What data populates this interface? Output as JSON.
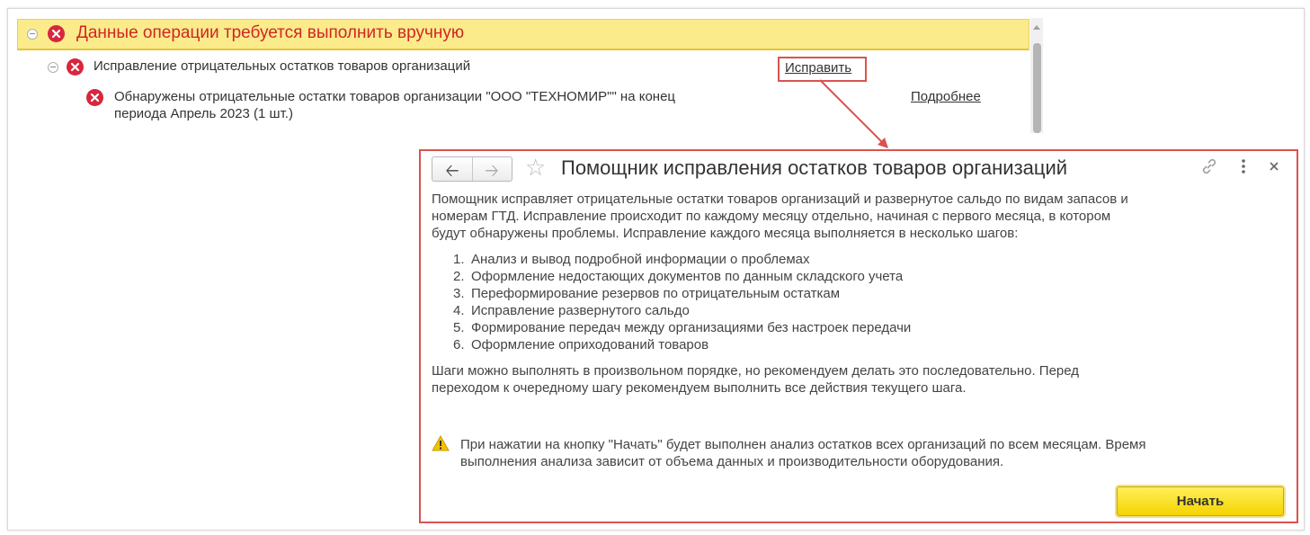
{
  "colors": {
    "group_bg": "#fbeb8b",
    "error_red": "#d7263d",
    "highlight_border": "#d9534f",
    "start_button": "#f4d400"
  },
  "list": {
    "group_title": "Данные операции требуется выполнить вручную",
    "item_title": "Исправление отрицательных остатков товаров организаций",
    "fix_link": "Исправить",
    "detail_line1": "Обнаружены отрицательные остатки товаров организации \"ООО \"ТЕХНОМИР\"\" на конец",
    "detail_line2": "периода Апрель 2023 (1 шт.)",
    "more_link": "Подробнее"
  },
  "dialog": {
    "title": "Помощник исправления остатков товаров организаций",
    "back_icon": "arrow-left-icon",
    "forward_icon": "arrow-right-icon",
    "favorite_icon": "star-icon",
    "link_icon": "link-icon",
    "more_icon": "more-vertical-icon",
    "close_icon": "close-icon",
    "intro_lines": [
      "Помощник исправляет отрицательные остатки товаров организаций и развернутое сальдо по видам запасов и",
      "номерам ГТД. Исправление происходит по каждому месяцу отдельно, начиная с первого месяца, в котором",
      "будут обнаружены проблемы. Исправление каждого месяца выполняется в несколько шагов:"
    ],
    "steps": [
      {
        "num": "1.",
        "text": "Анализ и вывод подробной информации о проблемах"
      },
      {
        "num": "2.",
        "text": "Оформление недостающих документов по данным складского учета"
      },
      {
        "num": "3.",
        "text": "Переформирование резервов по отрицательным остаткам"
      },
      {
        "num": "4.",
        "text": "Исправление развернутого сальдо"
      },
      {
        "num": "5.",
        "text": "Формирование передач между организациями без настроек передачи"
      },
      {
        "num": "6.",
        "text": "Оформление оприходований товаров"
      }
    ],
    "para2_lines": [
      "Шаги можно выполнять в произвольном порядке, но рекомендуем делать это последовательно. Перед",
      "переходом к очередному шагу рекомендуем выполнить все действия текущего шага."
    ],
    "warning_lines": [
      "При нажатии на кнопку \"Начать\" будет выполнен анализ остатков всех организаций по всем месяцам. Время",
      "выполнения анализа зависит от объема данных и производительности оборудования."
    ],
    "start_button": "Начать"
  }
}
